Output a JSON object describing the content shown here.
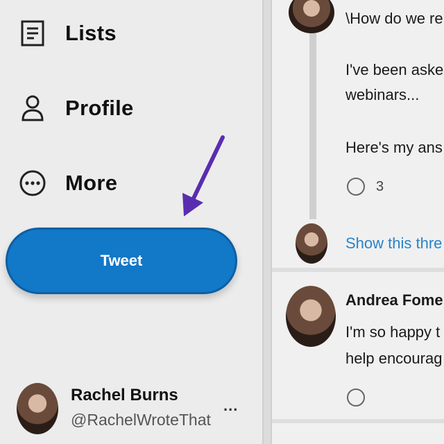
{
  "sidebar": {
    "nav": [
      {
        "label": "Lists",
        "icon": "list-icon"
      },
      {
        "label": "Profile",
        "icon": "person-icon"
      },
      {
        "label": "More",
        "icon": "more-circle-icon"
      }
    ],
    "tweet_button": {
      "label": "Tweet",
      "color": "#1278c8"
    },
    "annotation": {
      "icon": "arrow-icon",
      "color": "#5a2db0"
    },
    "account": {
      "name": "Rachel Burns",
      "handle": "@RachelWroteThat",
      "more": "..."
    }
  },
  "feed": {
    "tweet1": {
      "title": "\\How do we re",
      "line1": "I've been aske",
      "line2": "webinars...",
      "line3": "Here's my ans",
      "reply_count": "3"
    },
    "show_thread": "Show this thre",
    "tweet2": {
      "author": "Andrea Fome",
      "line1": "I'm so happy t",
      "line2": "help encourag"
    }
  }
}
